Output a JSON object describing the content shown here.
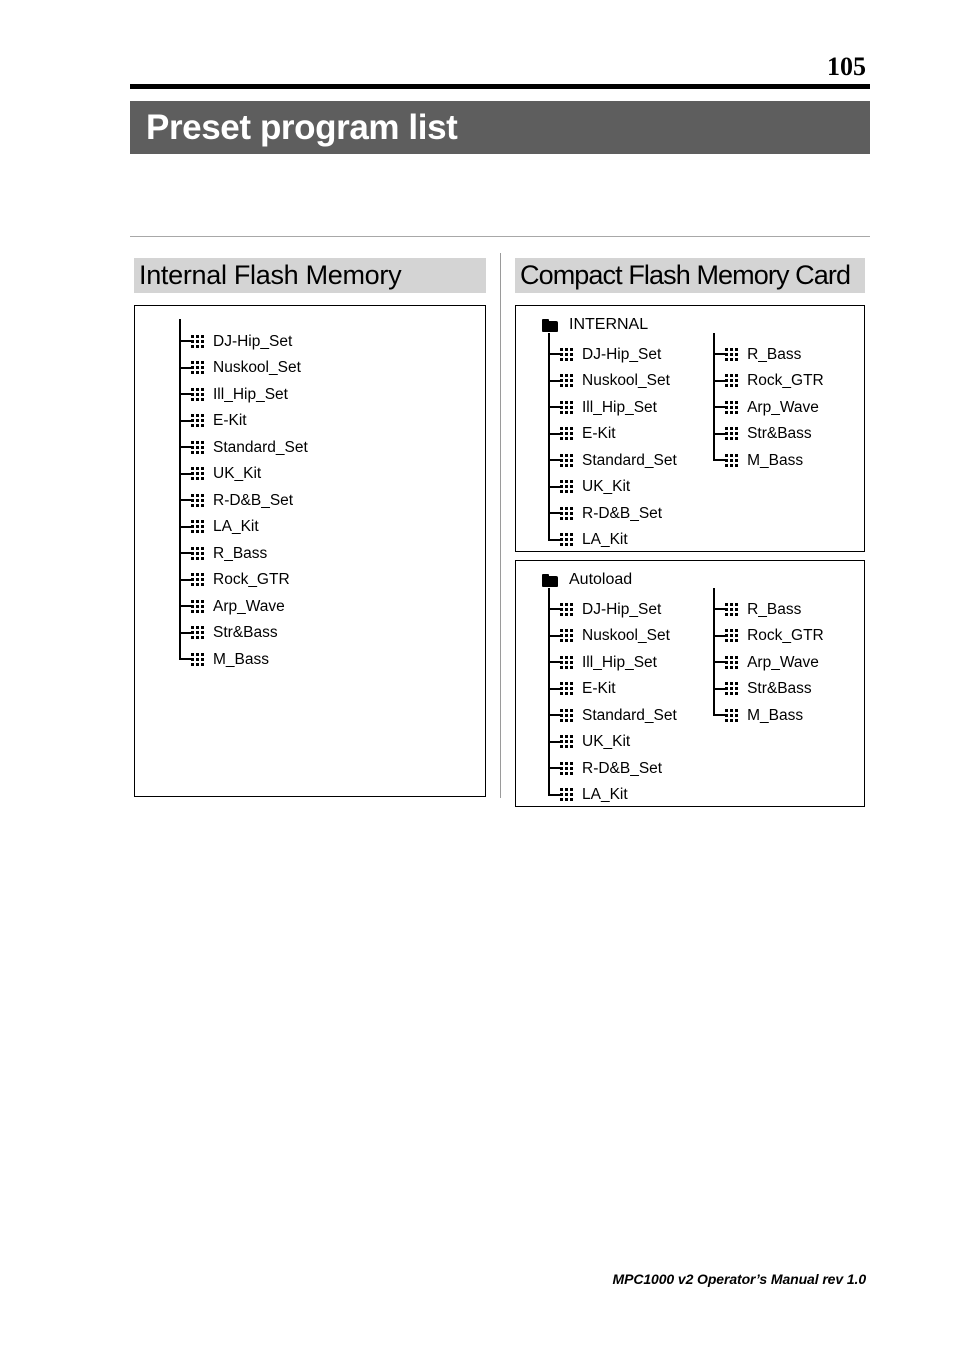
{
  "page": {
    "number": "105",
    "title": "Preset program list",
    "footer": "MPC1000 v2 Operator’s Manual rev 1.0",
    "colors": {
      "title_bar_bg": "#5e5e5e",
      "title_bar_text": "#ffffff",
      "section_head_bg": "#d4d4d4",
      "rule": "#a8a8a8",
      "panel_border": "#000000"
    }
  },
  "columns": {
    "internal_flash": {
      "heading": "Internal Flash Memory",
      "items": [
        "DJ-Hip_Set",
        "Nuskool_Set",
        "Ill_Hip_Set",
        "E-Kit",
        "Standard_Set",
        "UK_Kit",
        "R-D&B_Set",
        "LA_Kit",
        "R_Bass",
        "Rock_GTR",
        "Arp_Wave",
        "Str&Bass",
        "M_Bass"
      ]
    },
    "compact_flash": {
      "heading": "Compact Flash Memory Card",
      "folders": [
        {
          "name": "INTERNAL",
          "icon": "folder-icon",
          "column_a": [
            "DJ-Hip_Set",
            "Nuskool_Set",
            "Ill_Hip_Set",
            "E-Kit",
            "Standard_Set",
            "UK_Kit",
            "R-D&B_Set",
            "LA_Kit"
          ],
          "column_b": [
            "R_Bass",
            "Rock_GTR",
            "Arp_Wave",
            "Str&Bass",
            "M_Bass"
          ]
        },
        {
          "name": "Autoload",
          "icon": "folder-icon",
          "column_a": [
            "DJ-Hip_Set",
            "Nuskool_Set",
            "Ill_Hip_Set",
            "E-Kit",
            "Standard_Set",
            "UK_Kit",
            "R-D&B_Set",
            "LA_Kit"
          ],
          "column_b": [
            "R_Bass",
            "Rock_GTR",
            "Arp_Wave",
            "Str&Bass",
            "M_Bass"
          ]
        }
      ]
    }
  }
}
